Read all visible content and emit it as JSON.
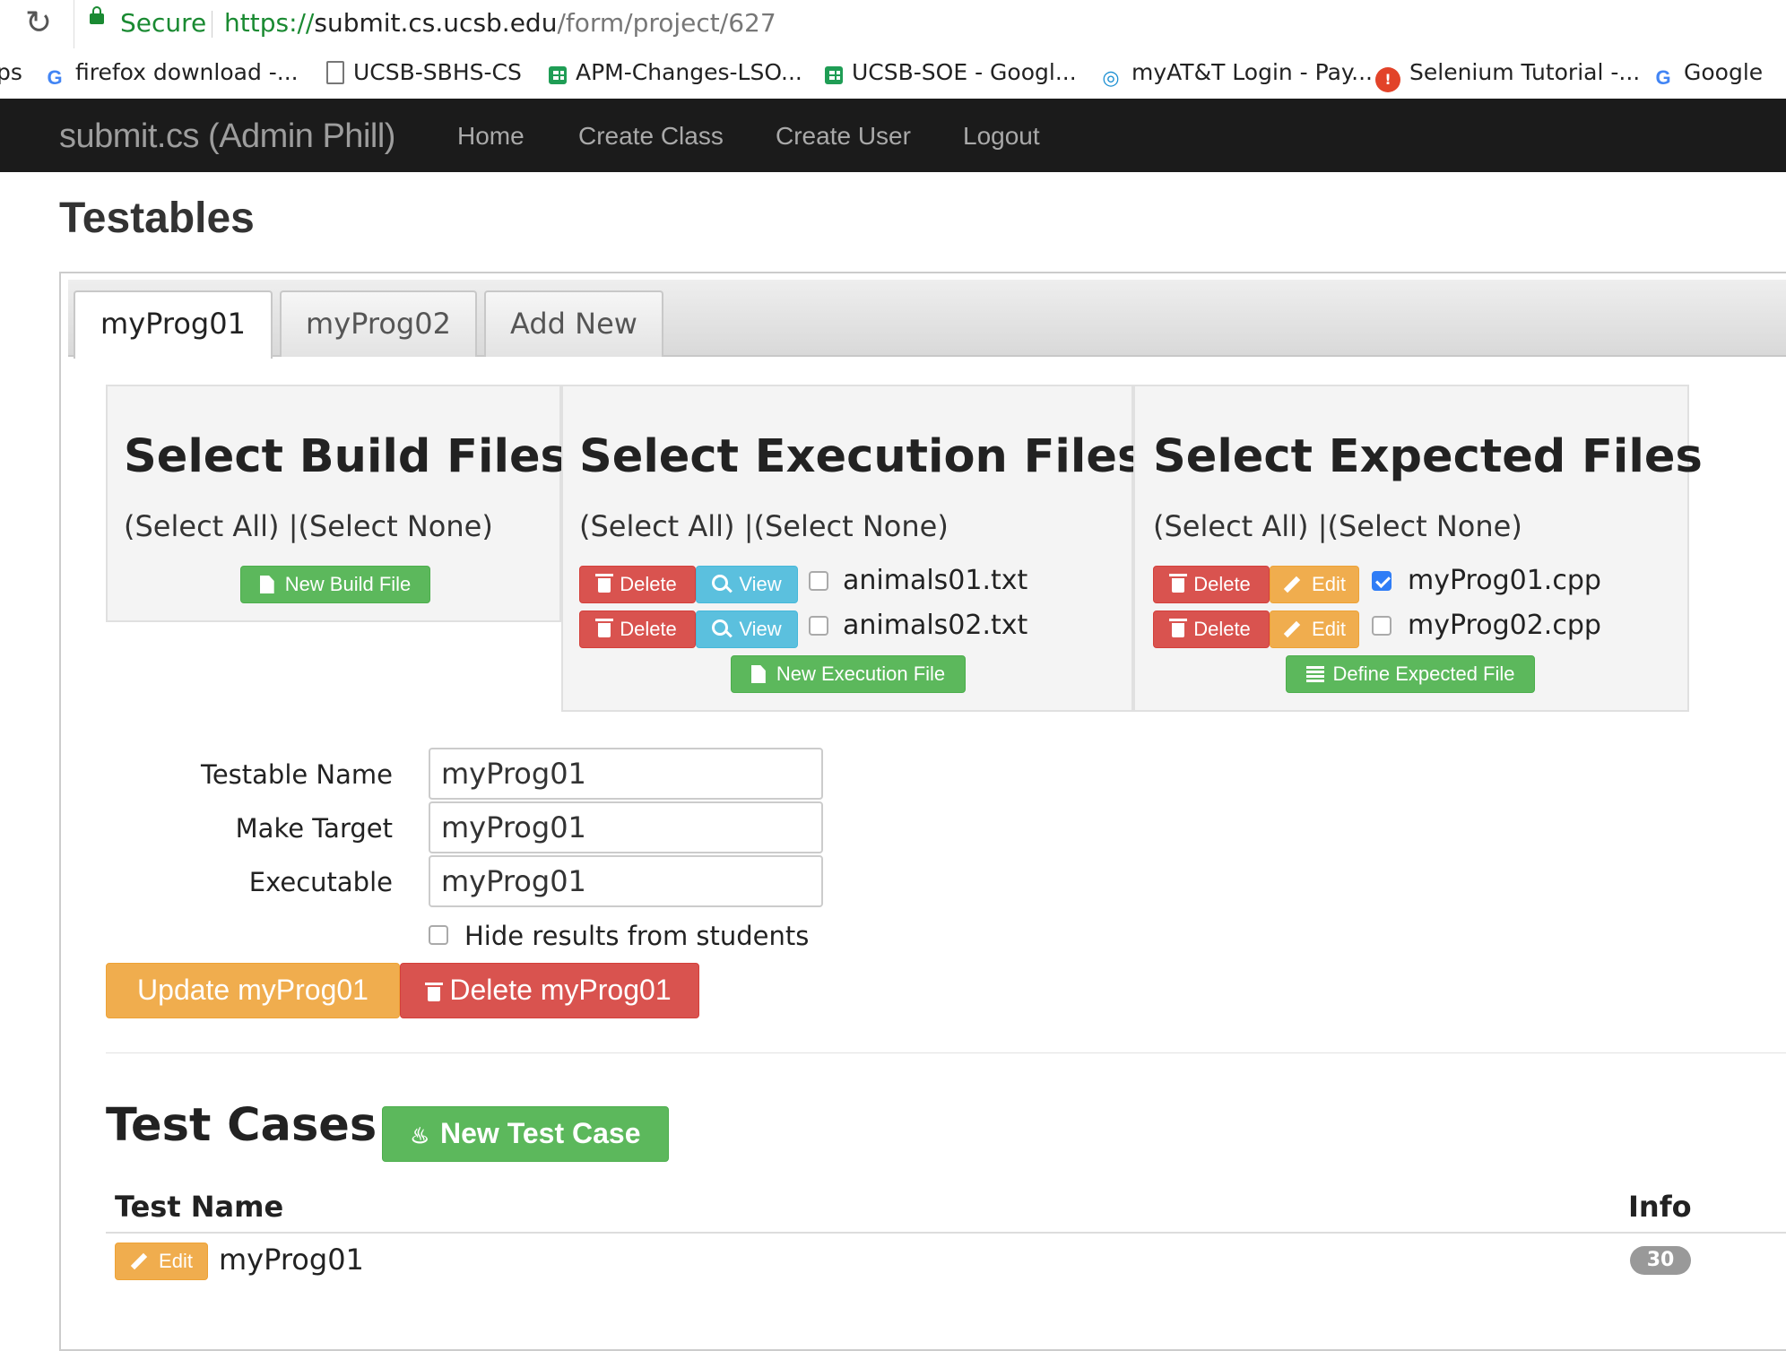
{
  "browser": {
    "secure_label": "Secure",
    "url_protocol": "https://",
    "url_host": "submit.cs.ucsb.edu",
    "url_path": "/form/project/627",
    "bookmarks": [
      {
        "label": "ps",
        "icon": "none"
      },
      {
        "label": "firefox download -...",
        "icon": "google-icon"
      },
      {
        "label": "UCSB-SBHS-CS",
        "icon": "page-icon"
      },
      {
        "label": "APM-Changes-LSO...",
        "icon": "sheets-icon"
      },
      {
        "label": "UCSB-SOE - Googl...",
        "icon": "sheets-icon"
      },
      {
        "label": "myAT&T Login - Pay...",
        "icon": "att-icon"
      },
      {
        "label": "Selenium Tutorial -...",
        "icon": "selenium-icon"
      },
      {
        "label": "Google",
        "icon": "google-icon"
      }
    ]
  },
  "navbar": {
    "brand": "submit.cs (Admin Phill)",
    "links": [
      "Home",
      "Create Class",
      "Create User",
      "Logout"
    ]
  },
  "page": {
    "title": "Testables",
    "tabs": [
      "myProg01",
      "myProg02",
      "Add New"
    ],
    "active_tab": "myProg01"
  },
  "build_files": {
    "title": "Select Build Files",
    "select_line": "(Select All) |(Select None)",
    "new_button": "New Build File"
  },
  "execution_files": {
    "title": "Select Execution Files",
    "select_line": "(Select All) |(Select None)",
    "files": [
      {
        "name": "animals01.txt",
        "checked": false,
        "delete": "Delete",
        "view": "View"
      },
      {
        "name": "animals02.txt",
        "checked": false,
        "delete": "Delete",
        "view": "View"
      }
    ],
    "new_button": "New Execution File"
  },
  "expected_files": {
    "title": "Select Expected Files",
    "select_line": "(Select All) |(Select None)",
    "files": [
      {
        "name": "myProg01.cpp",
        "checked": true,
        "delete": "Delete",
        "edit": "Edit"
      },
      {
        "name": "myProg02.cpp",
        "checked": false,
        "delete": "Delete",
        "edit": "Edit"
      }
    ],
    "define_button": "Define Expected File"
  },
  "form": {
    "testable_name_label": "Testable Name",
    "testable_name_value": "myProg01",
    "make_target_label": "Make Target",
    "make_target_value": "myProg01",
    "executable_label": "Executable",
    "executable_value": "myProg01",
    "hide_results_label": "Hide results from students",
    "hide_results_checked": false,
    "update_button": "Update myProg01",
    "delete_button": "Delete myProg01"
  },
  "test_cases": {
    "title": "Test Cases",
    "new_button": "New Test Case",
    "col_name": "Test Name",
    "col_info": "Info",
    "rows": [
      {
        "edit": "Edit",
        "name": "myProg01",
        "info": "30"
      }
    ]
  },
  "colors": {
    "navbar_bg": "#1b1b1b",
    "success": "#5cb85c",
    "danger": "#d9534f",
    "info": "#5bc0de",
    "warning": "#f0ad4e",
    "secure_green": "#1a8a32"
  }
}
